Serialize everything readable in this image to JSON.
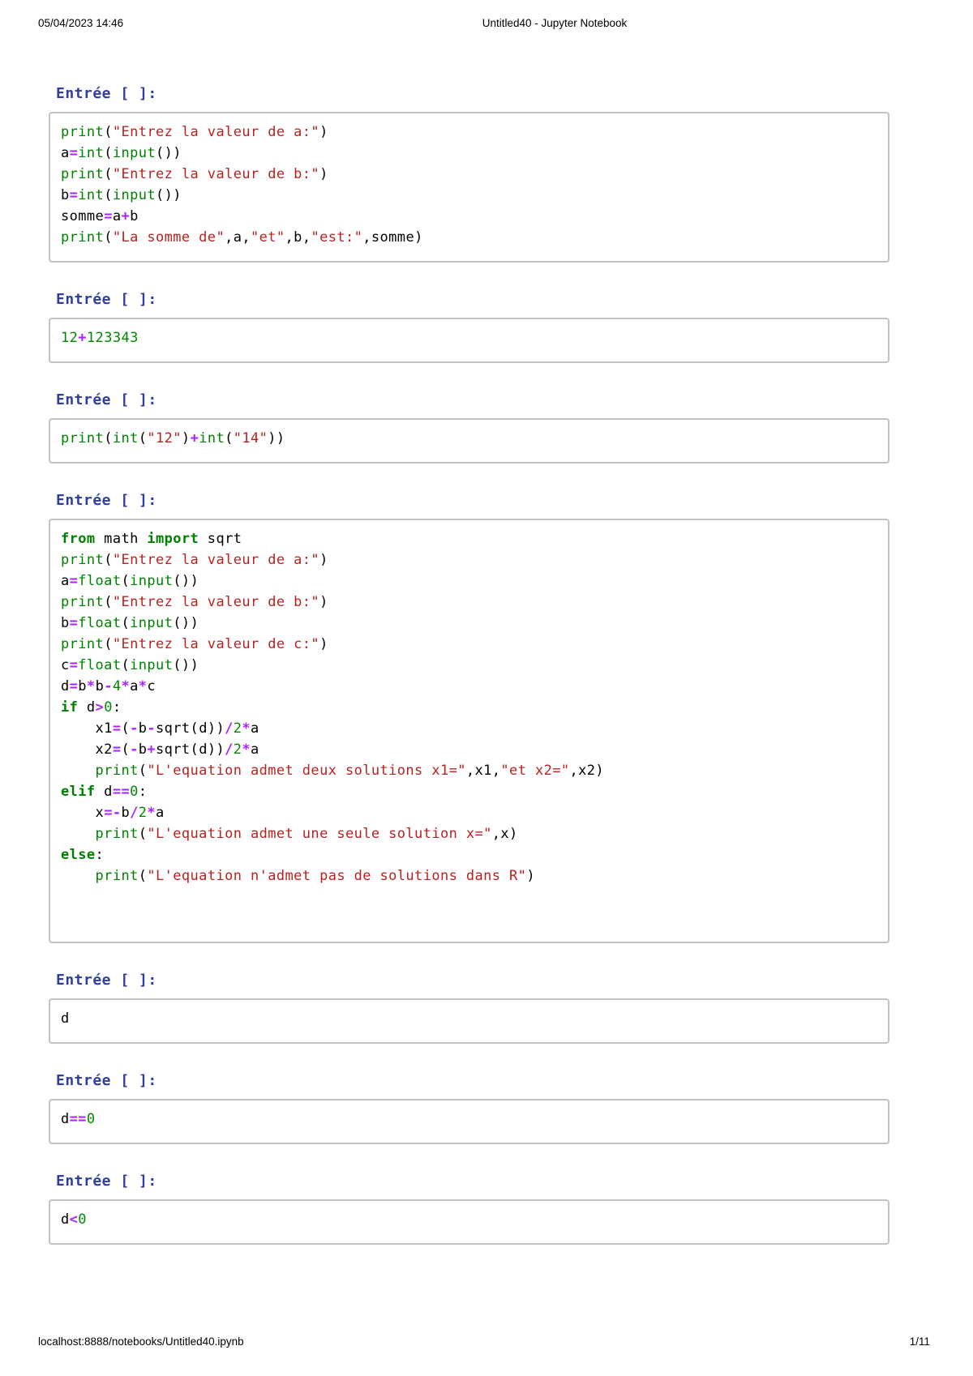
{
  "header": {
    "date": "05/04/2023 14:46",
    "title": "Untitled40 - Jupyter Notebook"
  },
  "footer": {
    "url": "localhost:8888/notebooks/Untitled40.ipynb",
    "page_number": "1/11"
  },
  "prompt_label": "Entrée [ ]:",
  "colors": {
    "prompt": "#303F9F",
    "keyword": "#008000",
    "builtin": "#008000",
    "string": "#BA2121",
    "number": "#008800",
    "operator": "#AA22FF",
    "plain": "#000000",
    "cell_border": "#C3C3C3"
  },
  "cells": [
    {
      "lines": [
        [
          [
            "b",
            "print"
          ],
          [
            "v",
            "("
          ],
          [
            "s",
            "\"Entrez la valeur de a:\""
          ],
          [
            "v",
            ")"
          ]
        ],
        [
          [
            "v",
            "a"
          ],
          [
            "o",
            "="
          ],
          [
            "b",
            "int"
          ],
          [
            "v",
            "("
          ],
          [
            "b",
            "input"
          ],
          [
            "v",
            "())"
          ]
        ],
        [
          [
            "b",
            "print"
          ],
          [
            "v",
            "("
          ],
          [
            "s",
            "\"Entrez la valeur de b:\""
          ],
          [
            "v",
            ")"
          ]
        ],
        [
          [
            "v",
            "b"
          ],
          [
            "o",
            "="
          ],
          [
            "b",
            "int"
          ],
          [
            "v",
            "("
          ],
          [
            "b",
            "input"
          ],
          [
            "v",
            "())"
          ]
        ],
        [
          [
            "v",
            "somme"
          ],
          [
            "o",
            "="
          ],
          [
            "v",
            "a"
          ],
          [
            "o",
            "+"
          ],
          [
            "v",
            "b"
          ]
        ],
        [
          [
            "b",
            "print"
          ],
          [
            "v",
            "("
          ],
          [
            "s",
            "\"La somme de\""
          ],
          [
            "v",
            ",a,"
          ],
          [
            "s",
            "\"et\""
          ],
          [
            "v",
            ",b,"
          ],
          [
            "s",
            "\"est:\""
          ],
          [
            "v",
            ",somme)"
          ]
        ]
      ]
    },
    {
      "lines": [
        [
          [
            "n",
            "12"
          ],
          [
            "o",
            "+"
          ],
          [
            "n",
            "123343"
          ]
        ]
      ]
    },
    {
      "lines": [
        [
          [
            "b",
            "print"
          ],
          [
            "v",
            "("
          ],
          [
            "b",
            "int"
          ],
          [
            "v",
            "("
          ],
          [
            "s",
            "\"12\""
          ],
          [
            "v",
            ")"
          ],
          [
            "o",
            "+"
          ],
          [
            "b",
            "int"
          ],
          [
            "v",
            "("
          ],
          [
            "s",
            "\"14\""
          ],
          [
            "v",
            "))"
          ]
        ]
      ]
    },
    {
      "tail_blank_lines": 2,
      "lines": [
        [
          [
            "k",
            "from"
          ],
          [
            "v",
            " math "
          ],
          [
            "k",
            "import"
          ],
          [
            "v",
            " sqrt"
          ]
        ],
        [
          [
            "b",
            "print"
          ],
          [
            "v",
            "("
          ],
          [
            "s",
            "\"Entrez la valeur de a:\""
          ],
          [
            "v",
            ")"
          ]
        ],
        [
          [
            "v",
            "a"
          ],
          [
            "o",
            "="
          ],
          [
            "b",
            "float"
          ],
          [
            "v",
            "("
          ],
          [
            "b",
            "input"
          ],
          [
            "v",
            "())"
          ]
        ],
        [
          [
            "b",
            "print"
          ],
          [
            "v",
            "("
          ],
          [
            "s",
            "\"Entrez la valeur de b:\""
          ],
          [
            "v",
            ")"
          ]
        ],
        [
          [
            "v",
            "b"
          ],
          [
            "o",
            "="
          ],
          [
            "b",
            "float"
          ],
          [
            "v",
            "("
          ],
          [
            "b",
            "input"
          ],
          [
            "v",
            "())"
          ]
        ],
        [
          [
            "b",
            "print"
          ],
          [
            "v",
            "("
          ],
          [
            "s",
            "\"Entrez la valeur de c:\""
          ],
          [
            "v",
            ")"
          ]
        ],
        [
          [
            "v",
            "c"
          ],
          [
            "o",
            "="
          ],
          [
            "b",
            "float"
          ],
          [
            "v",
            "("
          ],
          [
            "b",
            "input"
          ],
          [
            "v",
            "())"
          ]
        ],
        [
          [
            "v",
            "d"
          ],
          [
            "o",
            "="
          ],
          [
            "v",
            "b"
          ],
          [
            "o",
            "*"
          ],
          [
            "v",
            "b"
          ],
          [
            "o",
            "-"
          ],
          [
            "n",
            "4"
          ],
          [
            "o",
            "*"
          ],
          [
            "v",
            "a"
          ],
          [
            "o",
            "*"
          ],
          [
            "v",
            "c"
          ]
        ],
        [
          [
            "k",
            "if"
          ],
          [
            "v",
            " d"
          ],
          [
            "o",
            ">"
          ],
          [
            "n",
            "0"
          ],
          [
            "v",
            ":"
          ]
        ],
        [
          [
            "v",
            "    x1"
          ],
          [
            "o",
            "="
          ],
          [
            "v",
            "("
          ],
          [
            "o",
            "-"
          ],
          [
            "v",
            "b"
          ],
          [
            "o",
            "-"
          ],
          [
            "v",
            "sqrt(d))"
          ],
          [
            "o",
            "/"
          ],
          [
            "n",
            "2"
          ],
          [
            "o",
            "*"
          ],
          [
            "v",
            "a"
          ]
        ],
        [
          [
            "v",
            "    x2"
          ],
          [
            "o",
            "="
          ],
          [
            "v",
            "("
          ],
          [
            "o",
            "-"
          ],
          [
            "v",
            "b"
          ],
          [
            "o",
            "+"
          ],
          [
            "v",
            "sqrt(d))"
          ],
          [
            "o",
            "/"
          ],
          [
            "n",
            "2"
          ],
          [
            "o",
            "*"
          ],
          [
            "v",
            "a"
          ]
        ],
        [
          [
            "v",
            "    "
          ],
          [
            "b",
            "print"
          ],
          [
            "v",
            "("
          ],
          [
            "s",
            "\"L'equation admet deux solutions x1=\""
          ],
          [
            "v",
            ",x1,"
          ],
          [
            "s",
            "\"et x2=\""
          ],
          [
            "v",
            ",x2)"
          ]
        ],
        [
          [
            "k",
            "elif"
          ],
          [
            "v",
            " d"
          ],
          [
            "o",
            "=="
          ],
          [
            "n",
            "0"
          ],
          [
            "v",
            ":"
          ]
        ],
        [
          [
            "v",
            "    x"
          ],
          [
            "o",
            "=-"
          ],
          [
            "v",
            "b"
          ],
          [
            "o",
            "/"
          ],
          [
            "n",
            "2"
          ],
          [
            "o",
            "*"
          ],
          [
            "v",
            "a"
          ]
        ],
        [
          [
            "v",
            "    "
          ],
          [
            "b",
            "print"
          ],
          [
            "v",
            "("
          ],
          [
            "s",
            "\"L'equation admet une seule solution x=\""
          ],
          [
            "v",
            ",x)"
          ]
        ],
        [
          [
            "k",
            "else"
          ],
          [
            "v",
            ":"
          ]
        ],
        [
          [
            "v",
            "    "
          ],
          [
            "b",
            "print"
          ],
          [
            "v",
            "("
          ],
          [
            "s",
            "\"L'equation n'admet pas de solutions dans R\""
          ],
          [
            "v",
            ")"
          ]
        ]
      ]
    },
    {
      "lines": [
        [
          [
            "v",
            "d"
          ]
        ]
      ]
    },
    {
      "lines": [
        [
          [
            "v",
            "d"
          ],
          [
            "o",
            "=="
          ],
          [
            "n",
            "0"
          ]
        ]
      ]
    },
    {
      "lines": [
        [
          [
            "v",
            "d"
          ],
          [
            "o",
            "<"
          ],
          [
            "n",
            "0"
          ]
        ]
      ]
    }
  ]
}
